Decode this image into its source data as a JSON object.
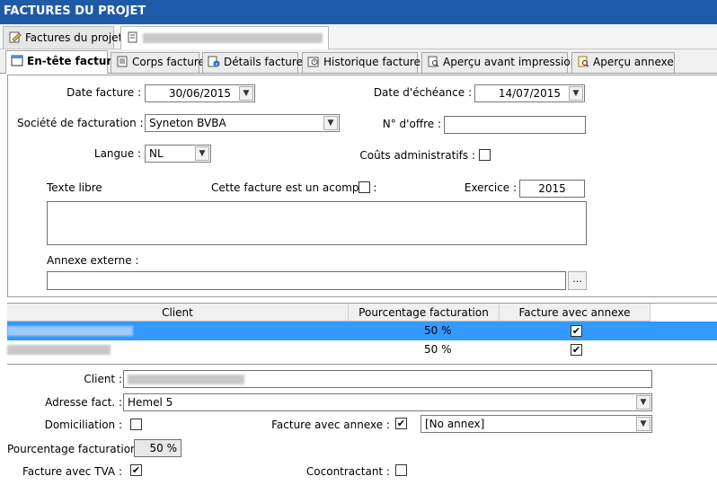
{
  "window": {
    "title": "FACTURES DU PROJET"
  },
  "doc_tabs": {
    "tab1": "Factures du projet"
  },
  "sub_tabs": [
    "En-tête facture",
    "Corps facture",
    "Détails facture",
    "Historique facture",
    "Aperçu avant impression",
    "Aperçu annexe"
  ],
  "header_form": {
    "date_label": "Date facture :",
    "date_value": "30/06/2015",
    "echeance_label": "Date d'échéance :",
    "echeance_value": "14/07/2015",
    "societe_label": "Société de facturation :",
    "societe_value": "Syneton BVBA",
    "offre_label": "N° d'offre :",
    "offre_value": "",
    "langue_label": "Langue :",
    "langue_value": "NL",
    "couts_label": "Coûts administratifs :",
    "couts_checked": false,
    "texte_libre_label": "Texte libre",
    "acompte_label": "Cette facture est un acompte :",
    "acompte_checked": false,
    "exercice_label": "Exercice :",
    "exercice_value": "2015",
    "texte_libre_value": "",
    "annexe_label": "Annexe externe :",
    "annexe_value": "",
    "browse_label": "..."
  },
  "grid": {
    "columns": [
      "Client",
      "Pourcentage facturation",
      "Facture avec annexe"
    ],
    "rows": [
      {
        "pct": "50 %",
        "annexe": "✔",
        "selected": true
      },
      {
        "pct": "50 %",
        "annexe": "✔",
        "selected": false
      }
    ]
  },
  "detail_form": {
    "client_label": "Client :",
    "adresse_label": "Adresse fact. :",
    "adresse_value": "Hemel 5",
    "domiciliation_label": "Domiciliation :",
    "domiciliation_checked": false,
    "facture_annexe_label": "Facture avec annexe :",
    "facture_annexe_check": "✔",
    "annexe_select": "[No annex]",
    "pourcentage_label": "Pourcentage facturation :",
    "pourcentage_value": "50 %",
    "tva_label": "Facture avec TVA :",
    "tva_check": "✔",
    "cocontractant_label": "Cocontractant :",
    "cocontractant_checked": false
  },
  "icons": [
    "doc-edit-icon",
    "doc-list-icon",
    "header-icon",
    "body-icon",
    "details-icon",
    "history-icon",
    "print-preview-icon",
    "annex-preview-icon",
    "dropdown-arrow-icon",
    "checkmark-icon"
  ],
  "colors": {
    "titlebar": "#1f5aa8",
    "selection": "#3399ff"
  }
}
